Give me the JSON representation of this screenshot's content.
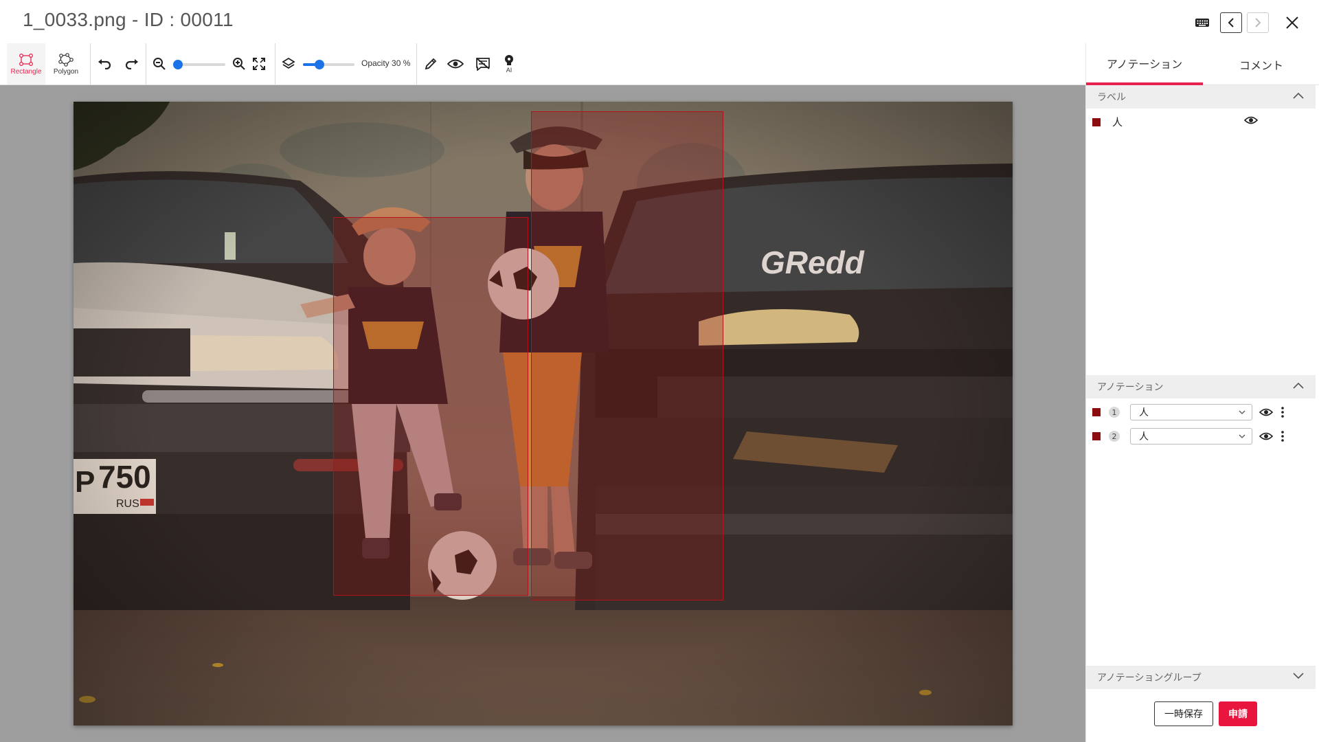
{
  "header": {
    "title": "1_0033.png - ID : 00011",
    "icons": [
      "keyboard-icon",
      "chevron-left-icon",
      "chevron-right-icon",
      "close-icon"
    ]
  },
  "toolbar": {
    "rectangle_label": "Rectangle",
    "polygon_label": "Polygon",
    "opacity_label": "Opacity 30 %",
    "opacity_value": 30,
    "ai_label": "AI",
    "accent_color": "#e8224f",
    "slider_color": "#1a73e8"
  },
  "panel": {
    "tabs": [
      {
        "label": "アノテーション",
        "active": true
      },
      {
        "label": "コメント",
        "active": false
      }
    ],
    "labels_section": {
      "title": "ラベル",
      "items": [
        {
          "name": "人",
          "color": "#8b0d10"
        }
      ]
    },
    "annotations_section": {
      "title": "アノテーション",
      "items": [
        {
          "index": "1",
          "label": "人",
          "color": "#8b0d10"
        },
        {
          "index": "2",
          "label": "人",
          "color": "#8b0d10"
        }
      ]
    },
    "groups_section": {
      "title": "アノテーショングループ"
    },
    "save_label": "一時保存",
    "submit_label": "申請",
    "submit_color": "#e8153e"
  },
  "image": {
    "plate_number": "P 750",
    "plate_region": "RUS",
    "car_decal": "GRedd"
  }
}
